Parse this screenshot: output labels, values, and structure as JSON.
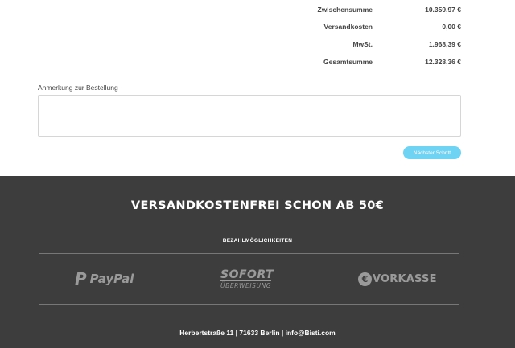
{
  "summary": {
    "rows": [
      {
        "label": "Zwischensumme",
        "value": "10.359,97 €"
      },
      {
        "label": "Versandkosten",
        "value": "0,00 €"
      },
      {
        "label": "MwSt.",
        "value": "1.968,39 €"
      },
      {
        "label": "Gesamtsumme",
        "value": "12.328,36 €"
      }
    ]
  },
  "order_note": {
    "label": "Anmerkung zur Bestellung",
    "value": ""
  },
  "next_button": {
    "label": "Nächster Schritt",
    "color": "#6fd3f4"
  },
  "footer": {
    "promo": "VERSANDKOSTENFREI SCHON AB 50€",
    "payment_title": "BEZAHLMÖGLICHKEITEN",
    "payment_methods": {
      "paypal": {
        "mark": "P",
        "text": "PayPal"
      },
      "sofort": {
        "top": "SOFORT",
        "bottom": "ÜBERWEISUNG"
      },
      "vorkasse": {
        "mark": "€",
        "text": "VORKASSE"
      }
    },
    "address": "Herbertstraße 11 | 71633 Berlin | info@Bisti.com",
    "background": "#3d3d3d"
  }
}
